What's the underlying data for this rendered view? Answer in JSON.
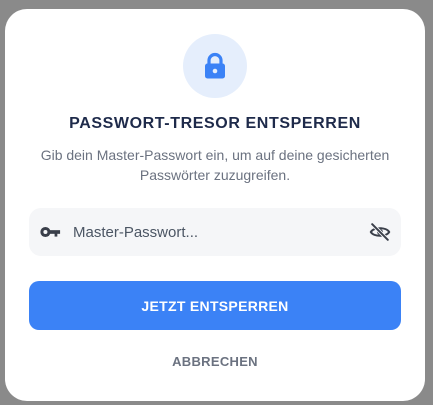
{
  "dialog": {
    "icon": "lock-icon",
    "title": "PASSWORT-TRESOR ENTSPERREN",
    "subtitle": "Gib dein Master-Passwort ein, um auf deine gesicherten Passwörter zuzugreifen.",
    "password_field": {
      "leading_icon": "key-icon",
      "placeholder": "Master-Passwort...",
      "value": "",
      "toggle_icon": "eye-off-icon"
    },
    "primary_button": "JETZT ENTSPERREN",
    "secondary_button": "ABBRECHEN"
  },
  "colors": {
    "accent": "#3b82f6",
    "icon_bg": "#e5eefc",
    "title": "#1e2a4a",
    "overlay": "#8a8a8a"
  }
}
